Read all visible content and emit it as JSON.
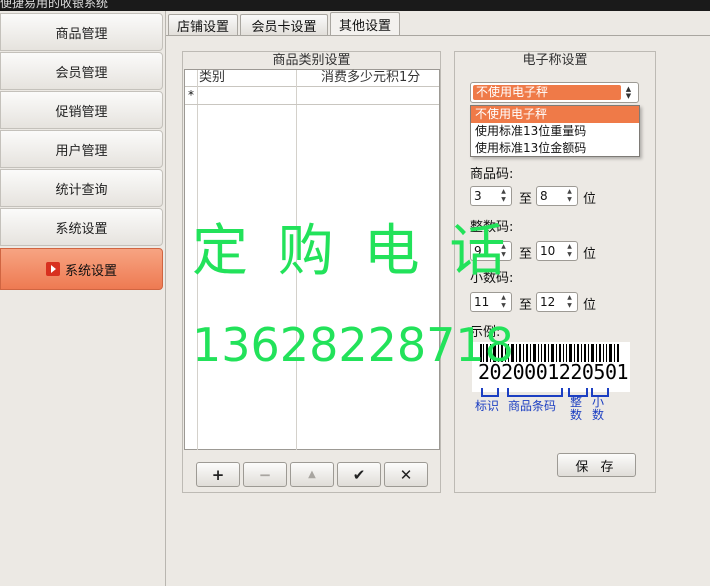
{
  "window": {
    "title": "便捷易用的收银系统"
  },
  "sidebar": {
    "items": [
      {
        "label": "商品管理"
      },
      {
        "label": "会员管理"
      },
      {
        "label": "促销管理"
      },
      {
        "label": "用户管理"
      },
      {
        "label": "统计查询"
      },
      {
        "label": "系统设置"
      },
      {
        "label": "系统设置"
      }
    ]
  },
  "tabs": [
    {
      "label": "店铺设置"
    },
    {
      "label": "会员卡设置"
    },
    {
      "label": "其他设置"
    }
  ],
  "category": {
    "title": "商品类别设置",
    "columns": [
      "类别",
      "消费多少元积1分"
    ],
    "new_row_marker": "*",
    "buttons": {
      "add": "+",
      "remove": "−",
      "up": "▲",
      "confirm": "✔",
      "cancel": "✕"
    }
  },
  "scale": {
    "title": "电子称设置",
    "selected": "不使用电子秤",
    "options": [
      "不使用电子秤",
      "使用标准13位重量码",
      "使用标准13位金额码"
    ],
    "product_code_label": "商品码:",
    "product_code": {
      "from": "3",
      "to": "8"
    },
    "integer_label": "整数码:",
    "integer_code": {
      "from": "9",
      "to": "10"
    },
    "decimal_label": "小数码:",
    "decimal_code": {
      "from": "11",
      "to": "12"
    },
    "to_word": "至",
    "unit_word": "位",
    "example_label": "示例:",
    "example_number": "2020001220501",
    "legend": {
      "mark": "标识",
      "product": "商品条码",
      "integer": "整\n数",
      "decimal": "小\n数"
    },
    "save_label": "保 存"
  },
  "watermark": {
    "line1": "定 购 电 话",
    "line2": "13628228718"
  },
  "colors": {
    "accent": "#ef7a48",
    "watermark": "#22e25a",
    "legend": "#1c3fc2"
  }
}
